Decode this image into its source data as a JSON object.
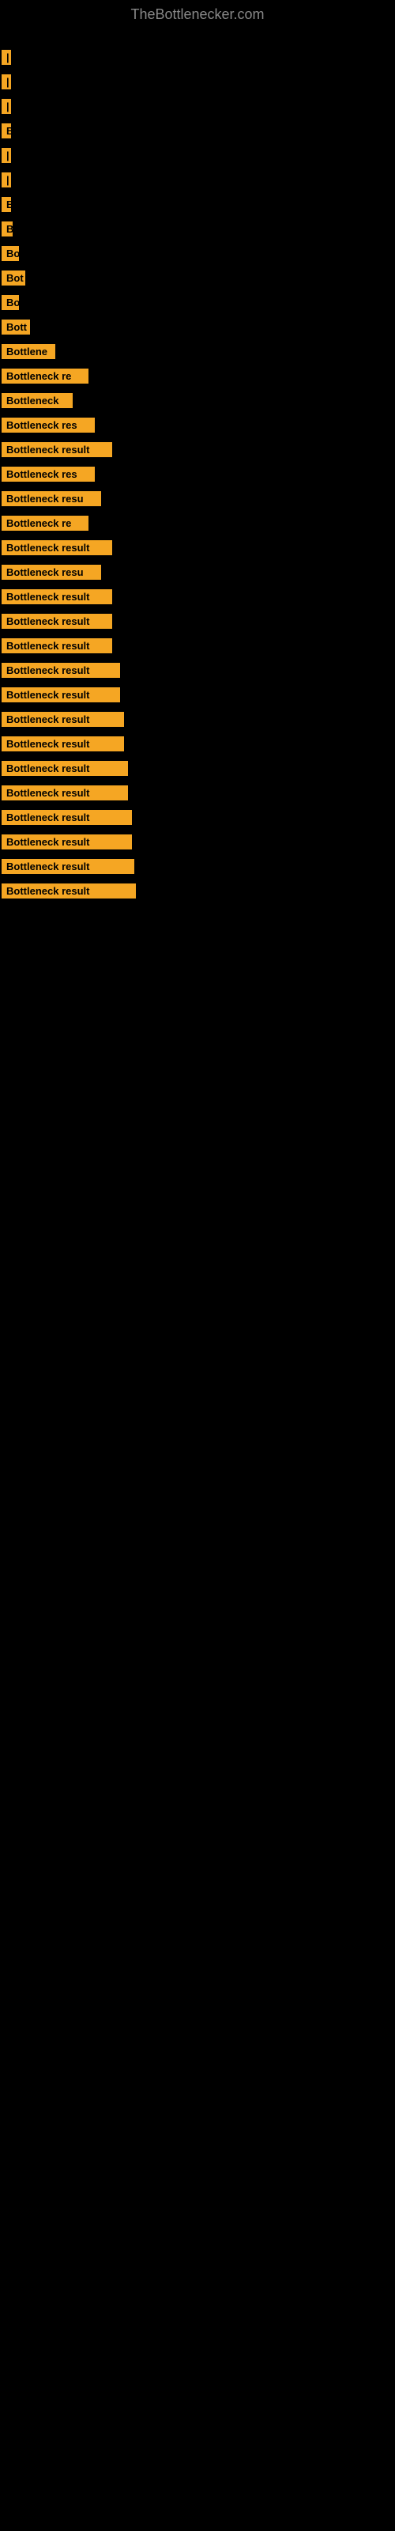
{
  "site": {
    "title": "TheBottlenecker.com"
  },
  "items": [
    {
      "id": 1,
      "label": "|",
      "width": 4
    },
    {
      "id": 2,
      "label": "|",
      "width": 4
    },
    {
      "id": 3,
      "label": "|",
      "width": 4
    },
    {
      "id": 4,
      "label": "B",
      "width": 10
    },
    {
      "id": 5,
      "label": "|",
      "width": 4
    },
    {
      "id": 6,
      "label": "|",
      "width": 4
    },
    {
      "id": 7,
      "label": "B",
      "width": 10
    },
    {
      "id": 8,
      "label": "B",
      "width": 14
    },
    {
      "id": 9,
      "label": "Bo",
      "width": 22
    },
    {
      "id": 10,
      "label": "Bot",
      "width": 30
    },
    {
      "id": 11,
      "label": "Bo",
      "width": 22
    },
    {
      "id": 12,
      "label": "Bott",
      "width": 36
    },
    {
      "id": 13,
      "label": "Bottlene",
      "width": 68
    },
    {
      "id": 14,
      "label": "Bottleneck re",
      "width": 110
    },
    {
      "id": 15,
      "label": "Bottleneck",
      "width": 90
    },
    {
      "id": 16,
      "label": "Bottleneck res",
      "width": 118
    },
    {
      "id": 17,
      "label": "Bottleneck result",
      "width": 140
    },
    {
      "id": 18,
      "label": "Bottleneck res",
      "width": 118
    },
    {
      "id": 19,
      "label": "Bottleneck resu",
      "width": 126
    },
    {
      "id": 20,
      "label": "Bottleneck re",
      "width": 110
    },
    {
      "id": 21,
      "label": "Bottleneck result",
      "width": 140
    },
    {
      "id": 22,
      "label": "Bottleneck resu",
      "width": 126
    },
    {
      "id": 23,
      "label": "Bottleneck result",
      "width": 140
    },
    {
      "id": 24,
      "label": "Bottleneck result",
      "width": 140
    },
    {
      "id": 25,
      "label": "Bottleneck result",
      "width": 140
    },
    {
      "id": 26,
      "label": "Bottleneck result",
      "width": 150
    },
    {
      "id": 27,
      "label": "Bottleneck result",
      "width": 150
    },
    {
      "id": 28,
      "label": "Bottleneck result",
      "width": 155
    },
    {
      "id": 29,
      "label": "Bottleneck result",
      "width": 155
    },
    {
      "id": 30,
      "label": "Bottleneck result",
      "width": 160
    },
    {
      "id": 31,
      "label": "Bottleneck result",
      "width": 160
    },
    {
      "id": 32,
      "label": "Bottleneck result",
      "width": 165
    },
    {
      "id": 33,
      "label": "Bottleneck result",
      "width": 165
    },
    {
      "id": 34,
      "label": "Bottleneck result",
      "width": 168
    },
    {
      "id": 35,
      "label": "Bottleneck result",
      "width": 170
    }
  ]
}
